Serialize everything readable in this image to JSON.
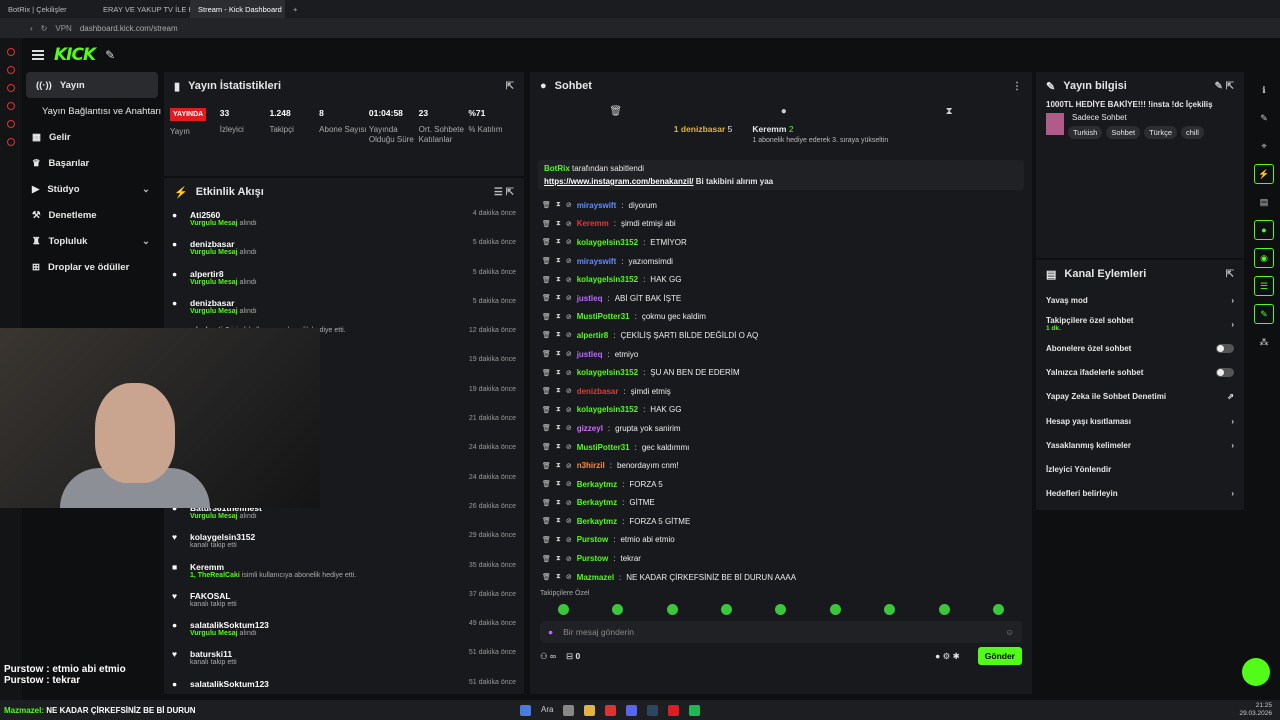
{
  "browser": {
    "tabs": [
      {
        "label": "BotRix | Çekilişler",
        "active": false
      },
      {
        "label": "ERAY VE YAKUP TV İLE K",
        "active": false
      },
      {
        "label": "Stream - Kick Dashboard",
        "active": true
      }
    ],
    "url": "dashboard.kick.com/stream",
    "vpn_label": "VPN"
  },
  "topbar": {
    "logo": "KICK"
  },
  "sidebar": {
    "items": [
      {
        "label": "Yayın",
        "selected": true
      },
      {
        "label": "Yayın Bağlantısı ve Anahtarı"
      },
      {
        "label": "Gelir"
      },
      {
        "label": "Başarılar"
      },
      {
        "label": "Stüdyo",
        "chevron": "⌄"
      },
      {
        "label": "Denetleme"
      },
      {
        "label": "Topluluk",
        "chevron": "⌄"
      },
      {
        "label": "Droplar ve ödüller"
      }
    ]
  },
  "stats": {
    "title": "Yayın İstatistikleri",
    "live_badge": "YAYINDA",
    "items": [
      {
        "value": "",
        "label": "Yayın"
      },
      {
        "value": "33",
        "label": "İzleyici"
      },
      {
        "value": "1.248",
        "label": "Takipçi"
      },
      {
        "value": "8",
        "label": "Abone Sayısı"
      },
      {
        "value": "01:04:58",
        "label": "Yayında Olduğu Süre"
      },
      {
        "value": "23",
        "label": "Ort. Sohbete Katılanlar"
      },
      {
        "value": "%71",
        "label": "% Katılım"
      }
    ]
  },
  "activity": {
    "title": "Etkinlik Akışı",
    "items": [
      {
        "icon": "●",
        "name": "Ati2560",
        "sub_hl": "Vurgulu Mesaj",
        "sub": "alındı",
        "time": "4 dakika önce"
      },
      {
        "icon": "●",
        "name": "denizbasar",
        "sub_hl": "Vurgulu Mesaj",
        "sub": "alındı",
        "time": "5 dakika önce"
      },
      {
        "icon": "●",
        "name": "alpertir8",
        "sub_hl": "Vurgulu Mesaj",
        "sub": "alındı",
        "time": "5 dakika önce"
      },
      {
        "icon": "●",
        "name": "denizbasar",
        "sub_hl": "Vurgulu Mesaj",
        "sub": "alındı",
        "time": "5 dakika önce"
      },
      {
        "icon": "",
        "name": "",
        "sub_hl": "yıl, alpertir8",
        "sub": "isimli kullanıcıya abonelik hediye etti.",
        "time": "12 dakika önce"
      },
      {
        "icon": "",
        "name": "",
        "sub_hl": "",
        "sub": "",
        "time": "19 dakika önce"
      },
      {
        "icon": "",
        "name": "",
        "sub_hl": "",
        "sub": "hediye etti.",
        "time": "19 dakika önce"
      },
      {
        "icon": "",
        "name": "",
        "sub_hl": "",
        "sub": "",
        "time": "21 dakika önce"
      },
      {
        "icon": "",
        "name": "",
        "sub_hl": "",
        "sub": "",
        "time": "24 dakika önce"
      },
      {
        "icon": "",
        "name": "",
        "sub_hl": "",
        "sub": "",
        "time": "24 dakika önce"
      },
      {
        "icon": "●",
        "name": "Batur361thefinest",
        "sub_hl": "Vurgulu Mesaj",
        "sub": "alındı",
        "time": "26 dakika önce"
      },
      {
        "icon": "♥",
        "name": "kolaygelsin3152",
        "sub_hl": "",
        "sub": "kanalı takip etti",
        "time": "29 dakika önce"
      },
      {
        "icon": "■",
        "name": "Keremm",
        "sub_hl": "1, TheRealCaki",
        "sub": "isimli kullanıcıya abonelik hediye etti.",
        "time": "35 dakika önce"
      },
      {
        "icon": "♥",
        "name": "FAKOSAL",
        "sub_hl": "",
        "sub": "kanalı takip etti",
        "time": "37 dakika önce"
      },
      {
        "icon": "●",
        "name": "salatalikSoktum123",
        "sub_hl": "Vurgulu Mesaj",
        "sub": "alındı",
        "time": "49 dakika önce"
      },
      {
        "icon": "♥",
        "name": "baturski11",
        "sub_hl": "",
        "sub": "kanalı takip etti",
        "time": "51 dakika önce"
      },
      {
        "icon": "●",
        "name": "salatalikSoktum123",
        "sub_hl": "",
        "sub": "",
        "time": "51 dakika önce"
      }
    ]
  },
  "overlay": {
    "lines": [
      "Purstow : etmio abi etmio",
      "Purstow : tekrar"
    ],
    "ticker_user": "Mazmazel:",
    "ticker_text": "NE KADAR ÇİRKEFSİNİZ BE Bİ DURUN"
  },
  "chat": {
    "title": "Sohbet",
    "top_gifter": {
      "rank": "1",
      "name": "denizbasar",
      "count": "5"
    },
    "second": {
      "name": "Keremm",
      "count": "2",
      "note": "1 abonelik hediye ederek 3. sıraya yükseltin"
    },
    "pinned": {
      "by": "BotRix",
      "by_suffix": "tarafından sabitlendi",
      "link": "https://www.instagram.com/benakanzil/",
      "text": "Bi takibini alırım yaa"
    },
    "messages": [
      {
        "user": "mirayswift",
        "color": "#5f8dff",
        "text": "diyorum"
      },
      {
        "user": "Keremm",
        "color": "#e03a3a",
        "text": "şimdi etmişi abi"
      },
      {
        "user": "kolaygelsin3152",
        "color": "#53fc18",
        "text": "ETMİYOR"
      },
      {
        "user": "mirayswift",
        "color": "#5f8dff",
        "text": "yazıomsimdi"
      },
      {
        "user": "kolaygelsin3152",
        "color": "#53fc18",
        "text": "HAK GG"
      },
      {
        "user": "justleq",
        "color": "#b46cff",
        "text": "ABİ GİT BAK İŞTE"
      },
      {
        "user": "MustiPotter31",
        "color": "#53fc18",
        "text": "çokmu gec kaldim"
      },
      {
        "user": "alpertir8",
        "color": "#53fc18",
        "text": "ÇEKİLİŞ ŞARTI BİLDE DEĞİLDİ O AQ"
      },
      {
        "user": "justleq",
        "color": "#b46cff",
        "text": "etmiyo"
      },
      {
        "user": "kolaygelsin3152",
        "color": "#53fc18",
        "text": "ŞU AN BEN DE EDERİM"
      },
      {
        "user": "denizbasar",
        "color": "#e03a3a",
        "text": "şimdi etmiş"
      },
      {
        "user": "kolaygelsin3152",
        "color": "#53fc18",
        "text": "HAK GG"
      },
      {
        "user": "gizzeyl",
        "color": "#d36cff",
        "text": "grupta yok sanirim"
      },
      {
        "user": "MustiPotter31",
        "color": "#53fc18",
        "text": "gec kaldımmı"
      },
      {
        "user": "n3hirzil",
        "color": "#ff8a3a",
        "text": "benordayım cnm!"
      },
      {
        "user": "Berkaytmz",
        "color": "#53fc18",
        "text": "FORZA 5"
      },
      {
        "user": "Berkaytmz",
        "color": "#53fc18",
        "text": "GİTME"
      },
      {
        "user": "Berkaytmz",
        "color": "#53fc18",
        "text": "FORZA 5 GİTME"
      },
      {
        "user": "Purstow",
        "color": "#53fc18",
        "text": "etmio abi etmio"
      },
      {
        "user": "Purstow",
        "color": "#53fc18",
        "text": "tekrar"
      },
      {
        "user": "Mazmazel",
        "color": "#53fc18",
        "text": "NE KADAR ÇİRKEFSİNİZ BE Bİ DURUN AAAA"
      }
    ],
    "followers_only": "Takipçilere Özel",
    "input_placeholder": "Bir mesaj gönderin",
    "foot_count": "0",
    "send_label": "Gönder"
  },
  "info": {
    "title": "Yayın bilgisi",
    "stream_title": "1000TL HEDİYE BAKİYE!!! !insta !dc İçekiliş",
    "category": "Sadece Sohbet",
    "tags": [
      "Turkish",
      "Sohbet",
      "Türkçe",
      "chill"
    ]
  },
  "actions": {
    "title": "Kanal Eylemleri",
    "items": [
      {
        "label": "Yavaş mod",
        "kind": "chevron"
      },
      {
        "label": "Takipçilere özel sohbet",
        "sub": "1 dk.",
        "kind": "chevron"
      },
      {
        "label": "Abonelere özel sohbet",
        "kind": "toggle"
      },
      {
        "label": "Yalnızca ifadelerle sohbet",
        "kind": "toggle"
      },
      {
        "label": "Yapay Zeka ile Sohbet Denetimi",
        "kind": "external"
      },
      {
        "label": "Hesap yaşı kısıtlaması",
        "kind": "chevron"
      },
      {
        "label": "Yasaklanmış kelimeler",
        "kind": "chevron"
      },
      {
        "label": "İzleyici Yönlendir",
        "kind": "none"
      },
      {
        "label": "Hedefleri belirleyin",
        "kind": "chevron"
      }
    ]
  },
  "taskbar": {
    "search": "Ara",
    "time": "21:25",
    "date": "29.03.2026"
  }
}
